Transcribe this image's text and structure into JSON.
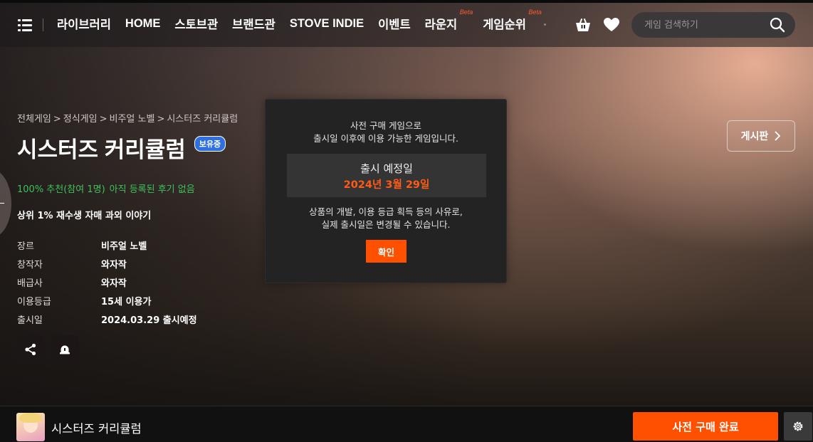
{
  "header": {
    "nav": [
      {
        "label": "라이브러리"
      },
      {
        "label": "HOME"
      },
      {
        "label": "스토브관"
      },
      {
        "label": "브랜드관"
      },
      {
        "label": "STOVE INDIE"
      },
      {
        "label": "이벤트"
      },
      {
        "label": "라운지",
        "badge": "Beta"
      },
      {
        "label": "게임순위",
        "badge": "Beta"
      }
    ],
    "search_placeholder": "게임 검색하기",
    "icons": {
      "menu": "menu-icon",
      "cart": "cart-icon",
      "wishlist": "heart-icon",
      "search": "search-icon"
    }
  },
  "breadcrumb": [
    "전체게임",
    ">",
    "정식게임",
    ">",
    "비주얼 노벨",
    ">",
    "시스터즈 커리큘럼"
  ],
  "game": {
    "title": "시스터즈 커리큘럼",
    "owned_badge": "보유중",
    "review_summary": "100% 추천(참여 1명)",
    "review_note": "아직 등록된 후기 없음",
    "tagline": "상위 1% 재수생 자매 과외 이야기",
    "info": [
      {
        "key": "장르",
        "value": "비주얼 노벨"
      },
      {
        "key": "창작자",
        "value": "와자작"
      },
      {
        "key": "배급사",
        "value": "와자작"
      },
      {
        "key": "이용등급",
        "value": "15세 이용가"
      },
      {
        "key": "출시일",
        "value": "2024.03.29 출시예정"
      }
    ]
  },
  "board_button": "게시판",
  "modal": {
    "message_line1": "사전 구매 게임으로",
    "message_line2": "출시일 이후에 이용 가능한 게임입니다.",
    "release_label": "출시 예정일",
    "release_date": "2024년 3월 29일",
    "note_line1": "상품의 개발, 이용 등급 획득 등의 사유로,",
    "note_line2": "실제 출시일은 변경될 수 있습니다.",
    "confirm": "확인"
  },
  "bottom_bar": {
    "title": "시스터즈 커리큘럼",
    "purchase_button": "사전 구매 완료"
  },
  "colors": {
    "accent": "#ff5000",
    "release_date": "#ff5a17",
    "review_green": "#3fc15a",
    "badge_blue": "#2f6fe0"
  }
}
